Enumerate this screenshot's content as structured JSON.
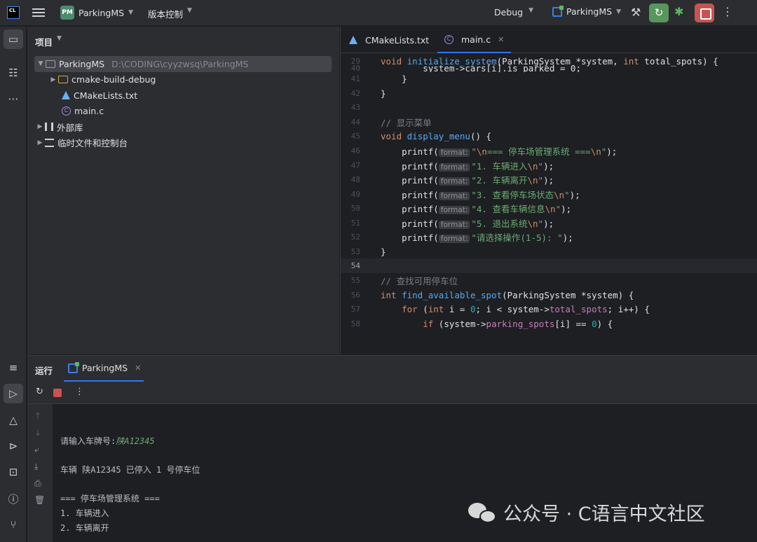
{
  "topbar": {
    "logo": "CL",
    "project_badge": "PM",
    "project_name": "ParkingMS",
    "vcs_label": "版本控制",
    "build_config": "Debug",
    "run_config": "ParkingMS"
  },
  "project_panel": {
    "title": "项目",
    "tree": [
      {
        "label": "ParkingMS",
        "path": "D:\\CODING\\cyyzwsq\\ParkingMS",
        "type": "project"
      },
      {
        "label": "cmake-build-debug",
        "type": "folder"
      },
      {
        "label": "CMakeLists.txt",
        "type": "cmake"
      },
      {
        "label": "main.c",
        "type": "c-file"
      },
      {
        "label": "外部库",
        "type": "library"
      },
      {
        "label": "临时文件和控制台",
        "type": "scratch"
      }
    ]
  },
  "editor": {
    "tabs": [
      {
        "label": "CMakeLists.txt"
      },
      {
        "label": "main.c"
      }
    ],
    "format_hint": "format:",
    "line_numbers": [
      "29",
      "40",
      "41",
      "42",
      "43",
      "44",
      "45",
      "46",
      "47",
      "48",
      "49",
      "50",
      "51",
      "52",
      "53",
      "54",
      "55",
      "56",
      "57",
      "58"
    ],
    "code": {
      "l29_a": "void ",
      "l29_b": "initialize_system",
      "l29_c": "(ParkingSystem *system, ",
      "l29_d": "int",
      "l29_e": " total_spots) {",
      "l40": "        system->cars[i].is_parked = 0;",
      "l41": "    }",
      "l42": "}",
      "l44": "// 显示菜单",
      "l45_a": "void ",
      "l45_b": "display_menu",
      "l45_c": "() {",
      "printf": "printf(",
      "l46_s1": "\"",
      "l46_e1": "\\n",
      "l46_s2": "=== 停车场管理系统 ===",
      "l46_e2": "\\n",
      "l46_s3": "\"",
      "l47_s": "\"1. 车辆进入",
      "l48_s": "\"2. 车辆离开",
      "l49_s": "\"3. 查看停车场状态",
      "l50_s": "\"4. 查看车辆信息",
      "l51_s": "\"5. 退出系统",
      "l52_s": "\"请选择操作(1-5): \"",
      "nl": "\\n",
      "q_close": "\"",
      "paren_close": ");",
      "l53": "}",
      "l55": "// 查找可用停车位",
      "l56_a": "int ",
      "l56_b": "find_available_spot",
      "l56_c": "(ParkingSystem *system) {",
      "l57_a": "for",
      "l57_b": " (",
      "l57_c": "int",
      "l57_d": " i = ",
      "l57_e": "0",
      "l57_f": "; i < system->",
      "l57_g": "total_spots",
      "l57_h": "; i++) {",
      "l58_a": "if",
      "l58_b": " (system->",
      "l58_c": "parking_spots",
      "l58_d": "[i] == ",
      "l58_e": "0",
      "l58_f": ") {"
    }
  },
  "run_panel": {
    "title": "运行",
    "tab_label": "ParkingMS",
    "console_lines": [
      {
        "prompt": "请输入车牌号:",
        "input": "陕A12345"
      },
      {
        "text": "车辆 陕A12345 已停入 1 号停车位"
      },
      {
        "text": "=== 停车场管理系统 ==="
      },
      {
        "text": "1. 车辆进入"
      },
      {
        "text": "2. 车辆离开"
      }
    ]
  },
  "watermark": {
    "text": "公众号 · C语言中文社区"
  },
  "colors": {
    "accent": "#3574f0",
    "run_green": "#57965c",
    "stop_red": "#c75450",
    "background": "#1e1f22",
    "panel": "#2b2d30"
  }
}
